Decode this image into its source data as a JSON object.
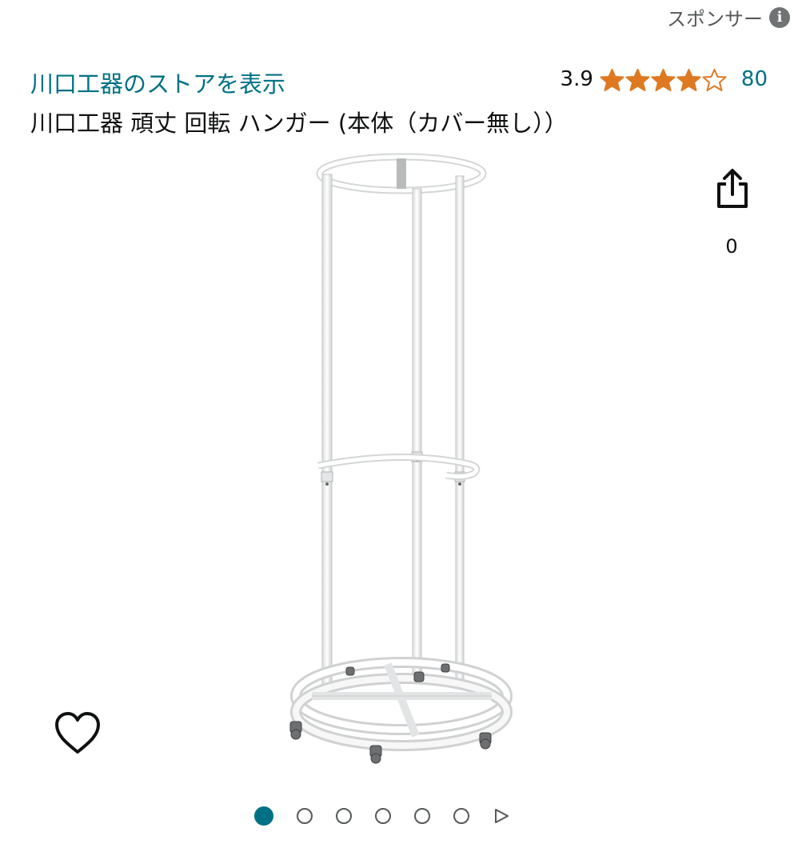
{
  "sponsor": {
    "label": "スポンサー",
    "icon": "info-icon",
    "icon_glyph": "i"
  },
  "store_link": "川口工器のストアを表示",
  "rating": {
    "score": "3.9",
    "stars": 3.9,
    "max_stars": 5,
    "review_count": "80",
    "star_color": "#de7921"
  },
  "title": "川口工器 頑丈 回転 ハンガー (本体（カバー無し））",
  "share": {
    "icon": "share-icon",
    "count": "0"
  },
  "wishlist": {
    "icon": "heart-outline-icon"
  },
  "carousel": {
    "total_dots": 6,
    "active_index": 0,
    "next_icon": "play-triangle-icon"
  },
  "colors": {
    "link": "#007185",
    "text": "#0f1111",
    "muted": "#565959",
    "active_dot": "#007185"
  }
}
